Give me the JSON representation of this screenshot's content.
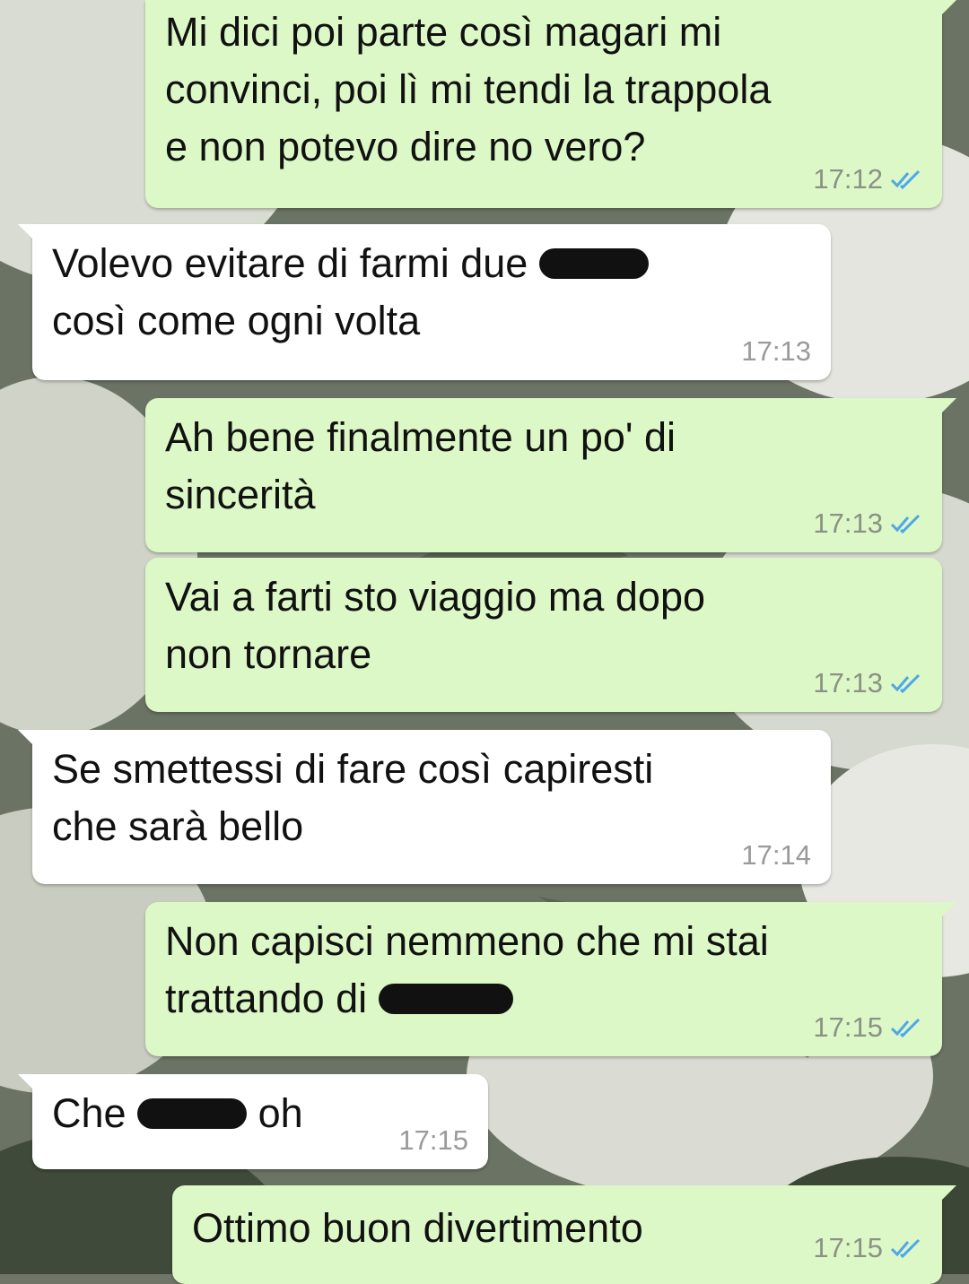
{
  "colors": {
    "outgoing_bubble": "#dcf8c6",
    "incoming_bubble": "#ffffff",
    "read_ticks": "#4fa6e8",
    "timestamp": "#8b9185"
  },
  "messages": [
    {
      "direction": "outgoing",
      "text": "Mi dici poi parte così magari mi\nconvinci, poi lì mi tendi la trappola\ne non potevo dire no vero?",
      "time": "17:12",
      "status": "read"
    },
    {
      "direction": "incoming",
      "text_before": "Volevo evitare di farmi due ",
      "text_after": "\ncosì come ogni volta",
      "redacted": true,
      "time": "17:13"
    },
    {
      "direction": "outgoing",
      "text": "Ah bene finalmente un po' di\nsincerità",
      "time": "17:13",
      "status": "read"
    },
    {
      "direction": "outgoing",
      "text": "Vai a farti sto viaggio ma dopo\nnon tornare",
      "time": "17:13",
      "status": "read"
    },
    {
      "direction": "incoming",
      "text": "Se smettessi di fare così capiresti\nche sarà bello",
      "time": "17:14"
    },
    {
      "direction": "outgoing",
      "text_before": "Non capisci nemmeno che mi stai\ntrattando di ",
      "text_after": "",
      "redacted": true,
      "time": "17:15",
      "status": "read"
    },
    {
      "direction": "incoming",
      "text_before": "Che ",
      "text_after": " oh",
      "redacted": true,
      "time": "17:15"
    },
    {
      "direction": "outgoing",
      "text": "Ottimo buon divertimento",
      "time": "17:15",
      "status": "read"
    }
  ]
}
